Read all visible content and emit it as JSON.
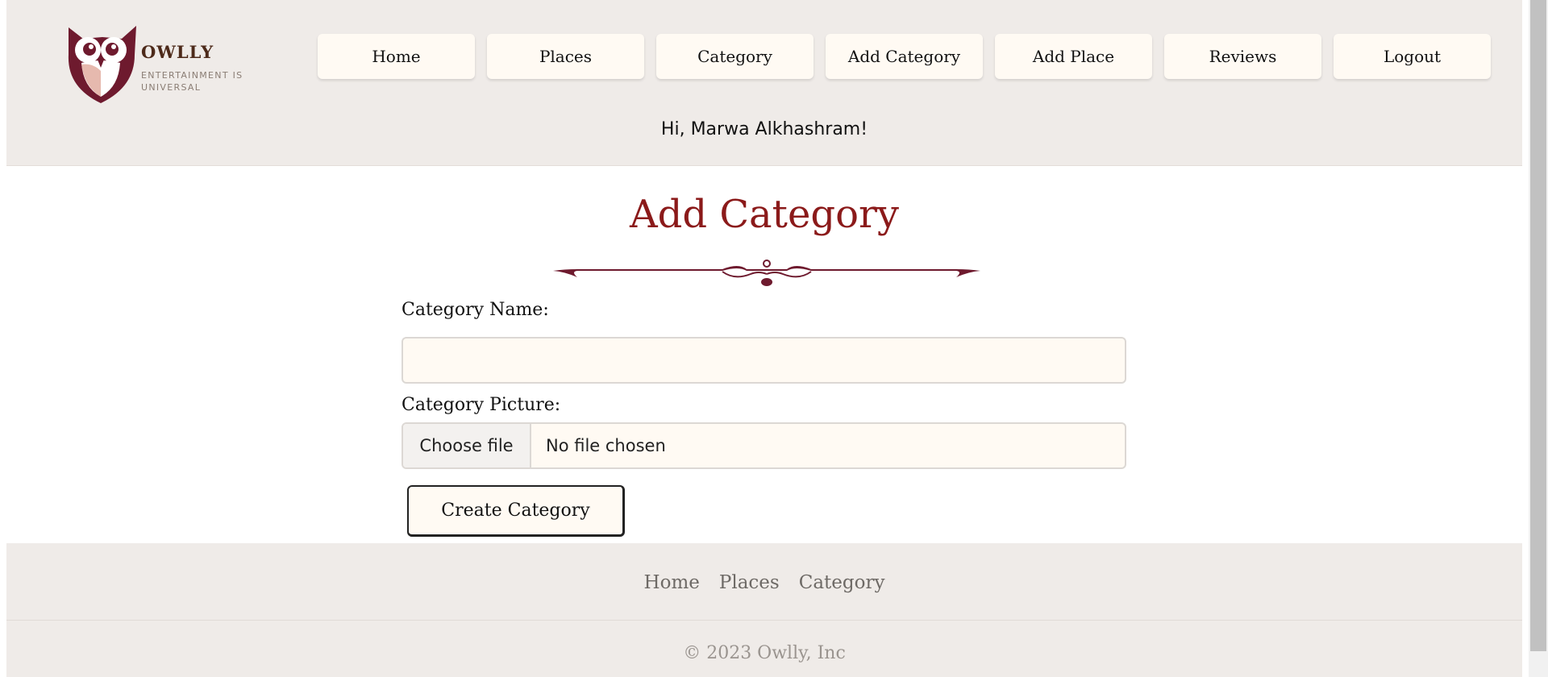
{
  "brand": {
    "name": "OWLLY",
    "tagline": "ENTERTAINMENT IS UNIVERSAL",
    "logo_icon": "owl-logo-icon"
  },
  "nav": {
    "items": [
      {
        "label": "Home"
      },
      {
        "label": "Places"
      },
      {
        "label": "Category"
      },
      {
        "label": "Add Category"
      },
      {
        "label": "Add Place"
      },
      {
        "label": "Reviews"
      },
      {
        "label": "Logout"
      }
    ]
  },
  "greeting": "Hi, Marwa Alkhashram!",
  "main": {
    "title": "Add Category",
    "divider_icon": "ornamental-divider-icon",
    "category_name_label": "Category Name:",
    "category_name_value": "",
    "category_picture_label": "Category Picture:",
    "file_button_label": "Choose file",
    "file_status": "No file chosen",
    "submit_label": "Create Category"
  },
  "footer": {
    "links": [
      {
        "label": "Home"
      },
      {
        "label": "Places"
      },
      {
        "label": "Category"
      }
    ],
    "copyright": "© 2023 Owlly, Inc"
  },
  "colors": {
    "accent": "#8b1a1a",
    "header_bg": "#efebe8",
    "button_bg": "#fffaf3",
    "logo_maroon": "#6e1a2e"
  }
}
